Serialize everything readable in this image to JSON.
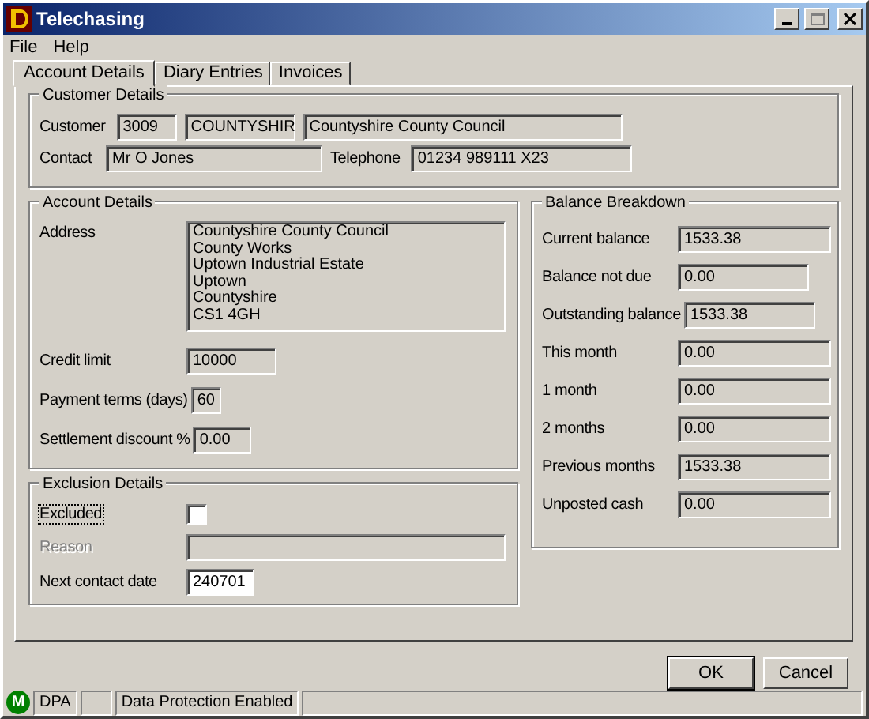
{
  "window": {
    "title": "Telechasing"
  },
  "menu": [
    {
      "label": "File"
    },
    {
      "label": "Help"
    }
  ],
  "tabs": [
    {
      "label": "Account Details",
      "selected": true
    },
    {
      "label": "Diary Entries",
      "selected": false
    },
    {
      "label": "Invoices",
      "selected": false
    }
  ],
  "customer_details": {
    "title": "Customer Details",
    "customer_label": "Customer",
    "customer_number": "3009",
    "customer_code": "COUNTYSHIR",
    "customer_name": "Countyshire County Council",
    "contact_label": "Contact",
    "contact": "Mr O Jones",
    "telephone_label": "Telephone",
    "telephone": "01234 989111 X23"
  },
  "account_details": {
    "title": "Account Details",
    "address_label": "Address",
    "address_lines": [
      "Countyshire County Council",
      "County Works",
      "Uptown Industrial Estate",
      "Uptown",
      "Countyshire",
      "CS1 4GH"
    ],
    "fields": [
      {
        "label": "Credit limit",
        "value": "10000"
      },
      {
        "label": "Payment terms (days)",
        "value": "60"
      },
      {
        "label": "Settlement discount %",
        "value": "0.00"
      }
    ]
  },
  "balance_breakdown": {
    "title": "Balance Breakdown",
    "fields": [
      {
        "label": "Current balance",
        "value": "1533.38"
      },
      {
        "label": "Balance not due",
        "value": "0.00"
      },
      {
        "label": "Outstanding balance",
        "value": "1533.38"
      },
      {
        "label": "This month",
        "value": "0.00"
      },
      {
        "label": "1 month",
        "value": "0.00"
      },
      {
        "label": "2 months",
        "value": "0.00"
      },
      {
        "label": "Previous months",
        "value": "1533.38"
      },
      {
        "label": "Unposted cash",
        "value": "0.00"
      }
    ]
  },
  "exclusion_details": {
    "title": "Exclusion Details",
    "excluded": {
      "label": "Excluded",
      "checked": false
    },
    "reason": {
      "label": "Reason",
      "disabled": true
    },
    "next_contact": {
      "label": "Next contact date",
      "value": "240701"
    }
  },
  "buttons": [
    {
      "label": "OK",
      "default": true
    },
    {
      "label": "Cancel",
      "default": false
    }
  ],
  "status_bar": {
    "indicator": "M",
    "panels": [
      "DPA",
      "Data Protection Enabled"
    ]
  }
}
